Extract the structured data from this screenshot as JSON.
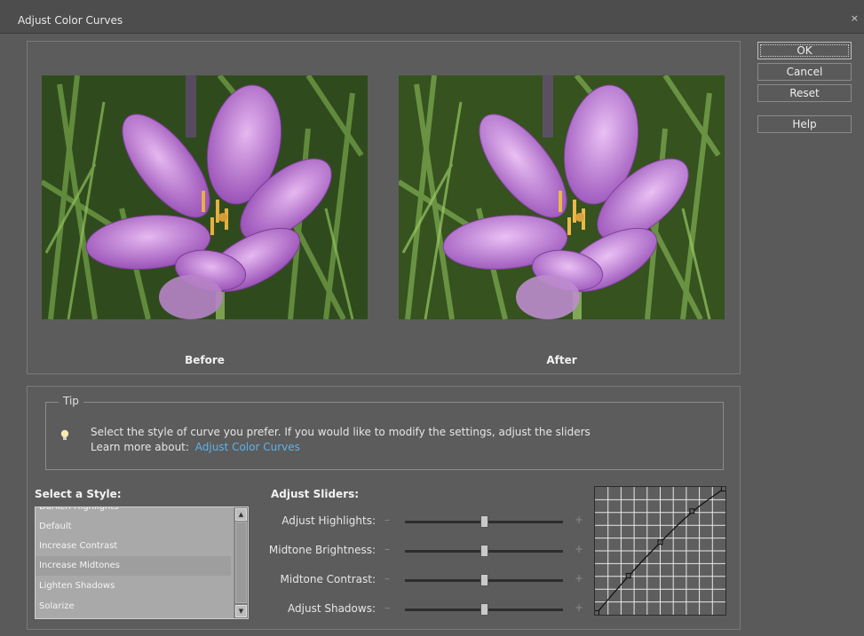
{
  "window": {
    "title": "Adjust Color Curves",
    "close_glyph": "×"
  },
  "preview": {
    "before_label": "Before",
    "after_label": "After"
  },
  "buttons": {
    "ok": "OK",
    "cancel": "Cancel",
    "reset": "Reset",
    "help": "Help"
  },
  "tip": {
    "legend": "Tip",
    "text": "Select the style of curve you prefer. If you would like to modify the settings, adjust the sliders",
    "learn_prefix": "Learn more about:",
    "link": "Adjust Color Curves",
    "icon": "lightbulb-icon"
  },
  "styles": {
    "heading": "Select a Style:",
    "items": [
      {
        "label": "Darken Highlights"
      },
      {
        "label": "Default"
      },
      {
        "label": "Increase Contrast"
      },
      {
        "label": "Increase Midtones"
      },
      {
        "label": "Lighten Shadows"
      },
      {
        "label": "Solarize"
      }
    ]
  },
  "sliders": {
    "heading": "Adjust Sliders:",
    "minus": "–",
    "plus": "+",
    "items": [
      {
        "label": "Adjust Highlights:",
        "value": 0.5
      },
      {
        "label": "Midtone Brightness:",
        "value": 0.5
      },
      {
        "label": "Midtone Contrast:",
        "value": 0.5
      },
      {
        "label": "Adjust Shadows:",
        "value": 0.5
      }
    ]
  },
  "curve": {
    "points": [
      [
        0,
        0
      ],
      [
        0.25,
        0.3
      ],
      [
        0.5,
        0.57
      ],
      [
        0.75,
        0.82
      ],
      [
        1,
        1
      ]
    ]
  },
  "colors": {
    "link": "#5fb2e6",
    "background": "#5a5a5a"
  }
}
